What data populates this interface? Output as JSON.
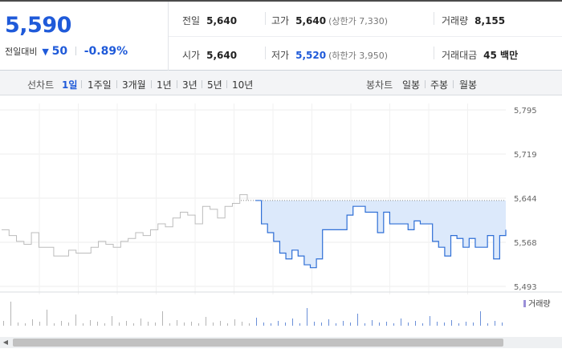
{
  "quote": {
    "price": "5,590",
    "change_label": "전일대비",
    "change_symbol": "▼",
    "change_amount": "50",
    "change_percent": "-0.89%"
  },
  "stats": {
    "prev_close": {
      "label": "전일",
      "value": "5,640"
    },
    "high": {
      "label": "고가",
      "value": "5,640",
      "limit": "(상한가 7,330)"
    },
    "volume": {
      "label": "거래량",
      "value": "8,155"
    },
    "open": {
      "label": "시가",
      "value": "5,640"
    },
    "low": {
      "label": "저가",
      "value": "5,520",
      "limit": "(하한가 3,950)"
    },
    "trade_value": {
      "label": "거래대금",
      "value": "45 백만"
    }
  },
  "tabs": {
    "line_label": "선차트",
    "line_tabs": [
      "1일",
      "1주일",
      "3개월",
      "1년",
      "3년",
      "5년",
      "10년"
    ],
    "line_active_index": 0,
    "candle_label": "봉차트",
    "candle_tabs": [
      "일봉",
      "주봉",
      "월봉"
    ]
  },
  "colors": {
    "accent_blue": "#1f5ad9",
    "line_blue": "#2f6fd6",
    "prev_day_line": "#bcbcbc",
    "area_fill": "#dce9fb"
  },
  "chart_data": {
    "type": "line",
    "y_ticks": [
      "5,795",
      "5,719",
      "5,644",
      "5,568",
      "5,493"
    ],
    "ylim": [
      5493,
      5795
    ],
    "reference_price": 5640,
    "volume_legend": "거래량",
    "prev_day_series": [
      5590,
      5580,
      5570,
      5565,
      5585,
      5560,
      5560,
      5545,
      5545,
      5555,
      5550,
      5550,
      5560,
      5570,
      5565,
      5560,
      5570,
      5575,
      5585,
      5580,
      5590,
      5600,
      5595,
      5610,
      5620,
      5615,
      5600,
      5630,
      5625,
      5610,
      5630,
      5635,
      5650,
      5640
    ],
    "today_series": [
      5640,
      5600,
      5585,
      5570,
      5550,
      5540,
      5555,
      5545,
      5530,
      5525,
      5540,
      5590,
      5590,
      5590,
      5590,
      5615,
      5630,
      5630,
      5620,
      5620,
      5585,
      5620,
      5600,
      5600,
      5600,
      5590,
      5605,
      5600,
      5600,
      5570,
      5560,
      5545,
      5580,
      5575,
      5560,
      5575,
      5560,
      5560,
      5580,
      5540,
      5580,
      5590
    ]
  }
}
